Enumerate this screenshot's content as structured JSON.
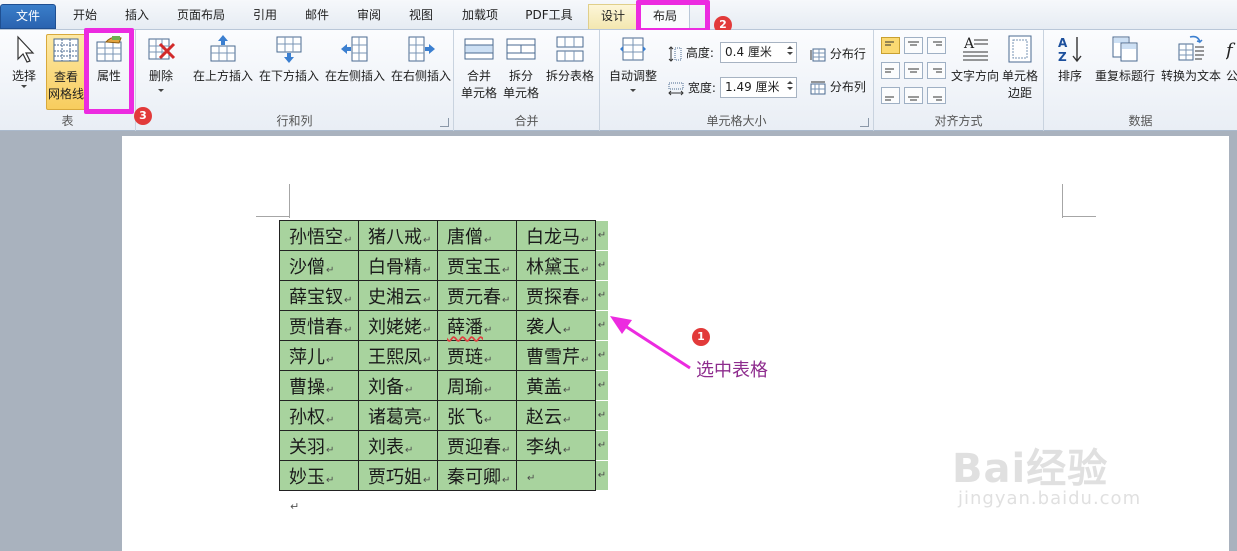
{
  "tabs": [
    {
      "label": "文件"
    },
    {
      "label": "开始"
    },
    {
      "label": "插入"
    },
    {
      "label": "页面布局"
    },
    {
      "label": "引用"
    },
    {
      "label": "邮件"
    },
    {
      "label": "审阅"
    },
    {
      "label": "视图"
    },
    {
      "label": "加载项"
    },
    {
      "label": "PDF工具"
    },
    {
      "label": "设计"
    },
    {
      "label": "布局"
    }
  ],
  "active_tab": "布局",
  "ribbon": {
    "table_group": {
      "label": "表",
      "select": "选择",
      "gridlines_line1": "查看",
      "gridlines_line2": "网格线",
      "properties": "属性"
    },
    "rows_cols_group": {
      "label": "行和列",
      "delete": "删除",
      "insert_above": "在上方插入",
      "insert_below": "在下方插入",
      "insert_left": "在左侧插入",
      "insert_right": "在右侧插入"
    },
    "merge_group": {
      "label": "合并",
      "merge_line1": "合并",
      "merge_line2": "单元格",
      "split_line1": "拆分",
      "split_line2": "单元格",
      "split_table": "拆分表格"
    },
    "cell_size_group": {
      "label": "单元格大小",
      "autofit": "自动调整",
      "height_label": "高度:",
      "height_value": "0.4 厘米",
      "width_label": "宽度:",
      "width_value": "1.49 厘米",
      "distribute_rows": "分布行",
      "distribute_cols": "分布列"
    },
    "align_group": {
      "label": "对齐方式",
      "text_direction": "文字方向",
      "cell_margins_line1": "单元格",
      "cell_margins_line2": "边距"
    },
    "data_group": {
      "label": "数据",
      "sort": "排序",
      "repeat_header": "重复标题行",
      "convert_text": "转换为文本",
      "formula_partial": "公"
    }
  },
  "table": {
    "rows": [
      [
        "孙悟空",
        "猪八戒",
        "唐僧",
        "白龙马"
      ],
      [
        "沙僧",
        "白骨精",
        "贾宝玉",
        "林黛玉"
      ],
      [
        "薛宝钗",
        "史湘云",
        "贾元春",
        "贾探春"
      ],
      [
        "贾惜春",
        "刘姥姥",
        "薛潘",
        "袭人"
      ],
      [
        "萍儿",
        "王熙凤",
        "贾琏",
        "曹雪芹"
      ],
      [
        "曹操",
        "刘备",
        "周瑜",
        "黄盖"
      ],
      [
        "孙权",
        "诸葛亮",
        "张飞",
        "赵云"
      ],
      [
        "关羽",
        "刘表",
        "贾迎春",
        "李纨"
      ],
      [
        "妙玉",
        "贾巧姐",
        "秦可卿",
        ""
      ]
    ],
    "paragraph_mark": "↵"
  },
  "annotations": {
    "step1": "1",
    "step2": "2",
    "step3": "3",
    "label": "选中表格",
    "highlight_color": "#ec2be0"
  },
  "watermark": {
    "logo_text": "Bai经验",
    "url_text": "jingyan.baidu.com"
  }
}
